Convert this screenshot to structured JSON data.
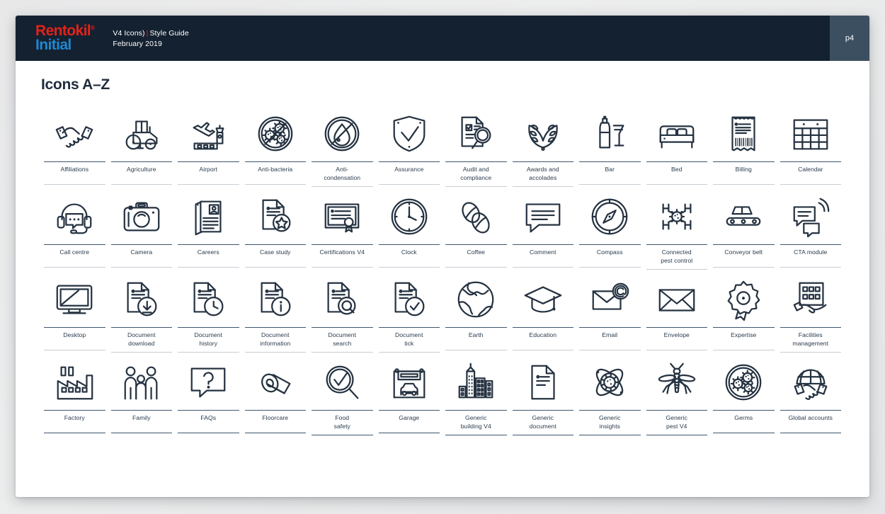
{
  "header": {
    "logo_line1": "Rentokil",
    "logo_registered": "®",
    "logo_line2": "Initial",
    "doc_line1_a": "V4 Icons)",
    "doc_separator": "|",
    "doc_line1_b": "Style Guide",
    "doc_line2": "February 2019",
    "page_badge": "p4",
    "colors": {
      "header_bg": "#142130",
      "badge_bg": "#3c4f60",
      "logo_red": "#E2231A",
      "logo_blue": "#1E88D2"
    }
  },
  "main": {
    "title": "Icons A–Z",
    "icon_stroke_color": "#253241",
    "rows": [
      {
        "items": [
          {
            "label": "Affiliations",
            "icon": "handshake-icon"
          },
          {
            "label": "Agriculture",
            "icon": "tractor-icon"
          },
          {
            "label": "Airport",
            "icon": "airport-icon"
          },
          {
            "label": "Anti-bacteria",
            "icon": "anti-bacteria-icon"
          },
          {
            "label": "Anti-\ncondensation",
            "icon": "anti-condensation-icon"
          },
          {
            "label": "Assurance",
            "icon": "shield-check-icon"
          },
          {
            "label": "Audit and\ncompliance",
            "icon": "audit-icon"
          },
          {
            "label": "Awards and\naccolades",
            "icon": "laurel-icon"
          },
          {
            "label": "Bar",
            "icon": "bar-drinks-icon"
          },
          {
            "label": "Bed",
            "icon": "bed-icon"
          },
          {
            "label": "Billing",
            "icon": "receipt-icon"
          },
          {
            "label": "Calendar",
            "icon": "calendar-icon"
          }
        ]
      },
      {
        "items": [
          {
            "label": "Call centre",
            "icon": "headset-icon"
          },
          {
            "label": "Camera",
            "icon": "camera-icon"
          },
          {
            "label": "Careers",
            "icon": "cv-documents-icon"
          },
          {
            "label": "Case study",
            "icon": "document-star-icon"
          },
          {
            "label": "Certifications V4",
            "icon": "certificate-icon"
          },
          {
            "label": "Clock",
            "icon": "clock-icon"
          },
          {
            "label": "Coffee",
            "icon": "coffee-beans-icon"
          },
          {
            "label": "Comment",
            "icon": "speech-bubble-icon"
          },
          {
            "label": "Compass",
            "icon": "compass-icon"
          },
          {
            "label": "Connected\npest control",
            "icon": "connected-pest-control-icon"
          },
          {
            "label": "Conveyor belt",
            "icon": "conveyor-belt-icon"
          },
          {
            "label": "CTA module",
            "icon": "cta-module-icon"
          }
        ]
      },
      {
        "items": [
          {
            "label": "Desktop",
            "icon": "desktop-icon"
          },
          {
            "label": "Document\ndownload",
            "icon": "document-download-icon"
          },
          {
            "label": "Document\nhistory",
            "icon": "document-history-icon"
          },
          {
            "label": "Document\ninformation",
            "icon": "document-information-icon"
          },
          {
            "label": "Document\nsearch",
            "icon": "document-search-icon"
          },
          {
            "label": "Document\ntick",
            "icon": "document-tick-icon"
          },
          {
            "label": "Earth",
            "icon": "earth-icon"
          },
          {
            "label": "Education",
            "icon": "graduation-cap-icon"
          },
          {
            "label": "Email",
            "icon": "email-icon"
          },
          {
            "label": "Envelope",
            "icon": "envelope-icon"
          },
          {
            "label": "Expertise",
            "icon": "rosette-icon"
          },
          {
            "label": "Facilities\nmanagement",
            "icon": "facilities-management-icon"
          }
        ]
      },
      {
        "items": [
          {
            "label": "Factory",
            "icon": "factory-icon"
          },
          {
            "label": "Family",
            "icon": "family-icon"
          },
          {
            "label": "FAQs",
            "icon": "faq-icon"
          },
          {
            "label": "Floorcare",
            "icon": "floorcare-icon"
          },
          {
            "label": "Food\nsafety",
            "icon": "food-safety-icon"
          },
          {
            "label": "Garage",
            "icon": "garage-icon"
          },
          {
            "label": "Generic\nbuilding V4",
            "icon": "generic-building-icon"
          },
          {
            "label": "Generic\ndocument",
            "icon": "generic-document-icon"
          },
          {
            "label": "Generic\ninsights",
            "icon": "generic-insights-icon"
          },
          {
            "label": "Generic\npest V4",
            "icon": "generic-pest-icon"
          },
          {
            "label": "Germs",
            "icon": "germs-icon"
          },
          {
            "label": "Global accounts",
            "icon": "global-accounts-icon"
          }
        ]
      }
    ]
  }
}
